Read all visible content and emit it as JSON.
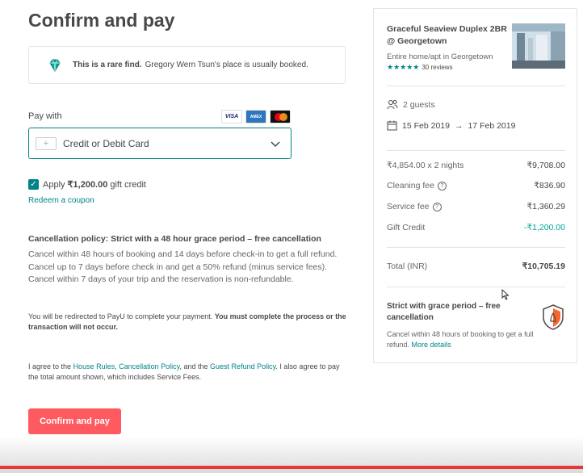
{
  "page": {
    "title": "Confirm and pay"
  },
  "rare": {
    "bold": "This is a rare find.",
    "text": "Gregory Wern Tsun's place is usually booked."
  },
  "payment": {
    "label": "Pay with",
    "cards": [
      "VISA",
      "AMEX",
      "Mastercard"
    ],
    "selected_method": "Credit or Debit Card"
  },
  "gift": {
    "prefix": "Apply",
    "amount": "₹1,200.00",
    "suffix": "gift credit",
    "checked": true
  },
  "coupon_link": "Redeem a coupon",
  "cancellation": {
    "heading": "Cancellation policy: Strict with a 48 hour grace period – free cancellation",
    "text": "Cancel within 48 hours of booking and 14 days before check-in to get a full refund. Cancel up to 7 days before check in and get a 50% refund (minus service fees). Cancel within 7 days of your trip and the reservation is non-refundable."
  },
  "redirect": {
    "normal": "You will be redirected to PayU to complete your payment.",
    "bold": "You must complete the process or the transaction will not occur."
  },
  "agree": {
    "p1": "I agree to the",
    "house_rules": "House Rules",
    "p2": ",",
    "cancellation_policy": "Cancellation Policy",
    "p3": ", and the",
    "refund_policy": "Guest Refund Policy",
    "p4": ". I also agree to pay the total amount shown, which includes Service Fees."
  },
  "confirm_button": "Confirm and pay",
  "listing": {
    "name": "Graceful Seaview Duplex 2BR @ Georgetown",
    "type": "Entire home/apt in Georgetown",
    "stars": "★★★★★",
    "reviews": "30 reviews"
  },
  "trip": {
    "guests": "2 guests",
    "check_in": "15 Feb 2019",
    "arrow": "→",
    "check_out": "17 Feb 2019"
  },
  "price": {
    "nights_label": "₹4,854.00 x 2 nights",
    "nights_value": "₹9,708.00",
    "cleaning_label": "Cleaning fee",
    "cleaning_value": "₹836.90",
    "service_label": "Service fee",
    "service_value": "₹1,360.29",
    "gift_label": "Gift Credit",
    "gift_value": "-₹1,200.00",
    "total_label": "Total (INR)",
    "total_value": "₹10,705.19"
  },
  "policy_box": {
    "heading": "Strict with grace period – free cancellation",
    "text": "Cancel within 48 hours of booking to get a full refund.",
    "link": "More details"
  },
  "colors": {
    "accent": "#008489",
    "button": "#ff5a5f",
    "credit": "#00a699"
  }
}
